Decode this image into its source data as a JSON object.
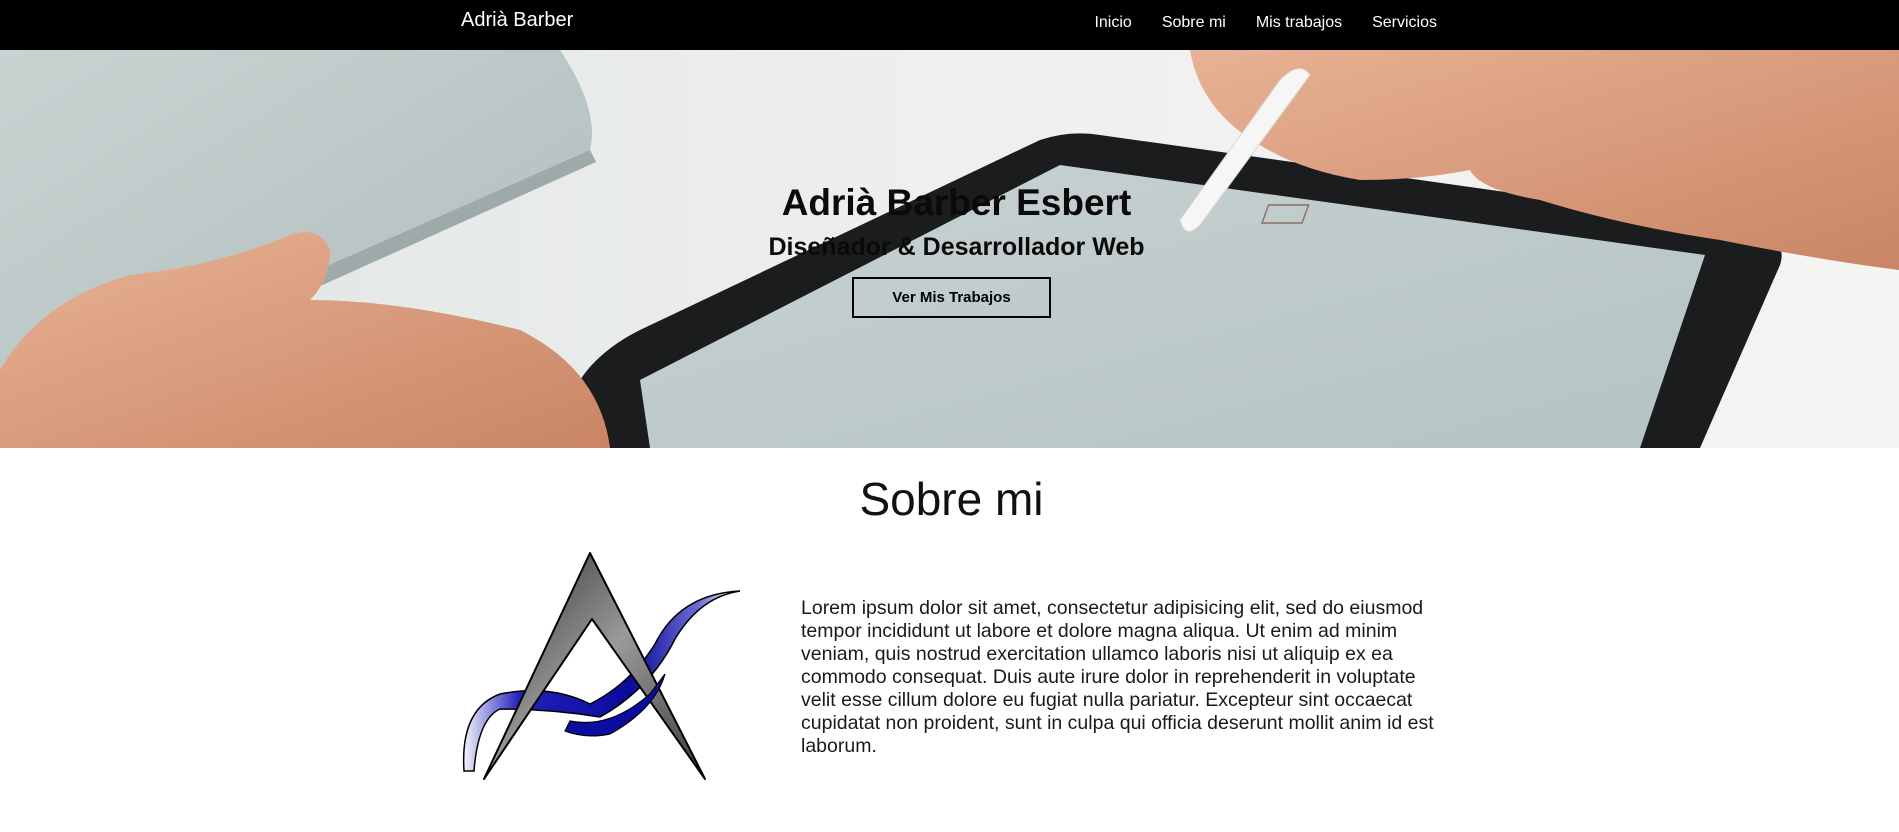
{
  "navbar": {
    "brand": "Adrià Barber",
    "links": [
      "Inicio",
      "Sobre mi",
      "Mis trabajos",
      "Servicios"
    ]
  },
  "hero": {
    "title": "Adrià Barber Esbert",
    "subtitle": "Diseñador & Desarrollador Web",
    "button_label": "Ver Mis Trabajos"
  },
  "about": {
    "title": "Sobre mi",
    "body": "Lorem ipsum dolor sit amet, consectetur adipisicing elit, sed do eiusmod tempor incididunt ut labore et dolore magna aliqua. Ut enim ad minim veniam, quis nostrud exercitation ullamco laboris nisi ut aliquip ex ea commodo consequat. Duis aute irure dolor in reprehenderit in voluptate velit esse cillum dolore eu fugiat nulla pariatur. Excepteur sint occaecat cupidatat non proident, sunt in culpa qui officia deserunt mollit anim id est laborum."
  },
  "colors": {
    "navbar_bg": "#000000",
    "accent_blue": "#1a1ab0"
  }
}
